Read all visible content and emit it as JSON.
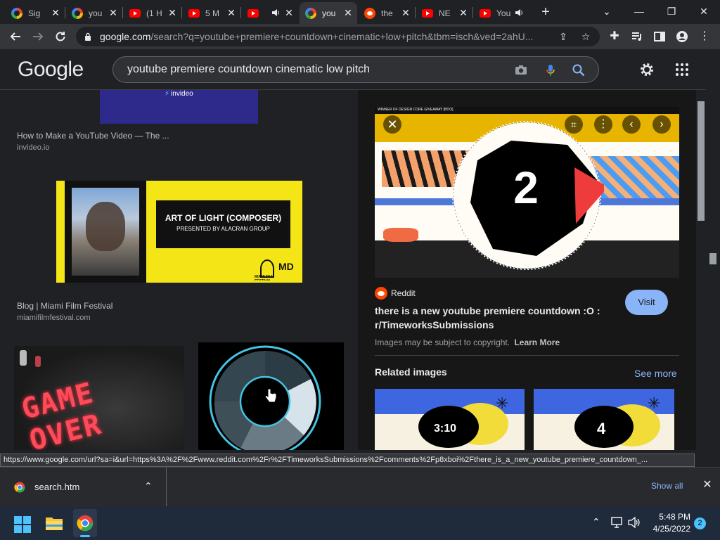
{
  "tabs": [
    {
      "label": "Sig",
      "favicon": "google-icon"
    },
    {
      "label": "you",
      "favicon": "google-icon"
    },
    {
      "label": "(1 H",
      "favicon": "youtube-icon"
    },
    {
      "label": "5 M",
      "favicon": "youtube-icon"
    },
    {
      "label": "",
      "favicon": "youtube-icon",
      "audio": true
    },
    {
      "label": "you",
      "favicon": "google-icon",
      "active": true
    },
    {
      "label": "the",
      "favicon": "reddit-icon"
    },
    {
      "label": "NE",
      "favicon": "youtube-icon"
    },
    {
      "label": "You",
      "favicon": "youtube-icon",
      "audio": true
    }
  ],
  "address": {
    "host": "google.com",
    "path": "/search?q=youtube+premiere+countdown+cinematic+low+pitch&tbm=isch&ved=2ahU..."
  },
  "google": {
    "logo": "Google",
    "query": "youtube premiere countdown cinematic low pitch"
  },
  "results": [
    {
      "title": "How to Make a YouTube Video — The ...",
      "source": "invideo.io",
      "thumb_text": "invideo"
    },
    {
      "title": "Blog | Miami Film Festival",
      "source": "miamifilmfestival.com",
      "thumb_heading": "ART OF LIGHT (COMPOSER)",
      "thumb_sub": "PRESENTED BY ALACRAN GROUP",
      "thumb_brand": "MIAMI FILM FESTIVAL"
    },
    {
      "thumb_text": "GAME OVER"
    }
  ],
  "panel": {
    "source": "Reddit",
    "preview_title": "WINNER OF DESIGN CORE GIVEAWAY [BOO]",
    "big_number": "2",
    "title_line1": "there is a new youtube premiere countdown :O :",
    "title_line2": "r/TimeworksSubmissions",
    "visit_label": "Visit",
    "copyright": "Images may be subject to copyright.",
    "learn_more": "Learn More",
    "related_heading": "Related images",
    "see_more": "See more",
    "related": [
      {
        "label": "3:10"
      },
      {
        "label": "4"
      }
    ]
  },
  "status_url": "https://www.google.com/url?sa=i&url=https%3A%2F%2Fwww.reddit.com%2Fr%2FTimeworksSubmissions%2Fcomments%2Fp8xboi%2Fthere_is_a_new_youtube_premiere_countdown_...",
  "download": {
    "filename": "search.htm",
    "show_all": "Show all"
  },
  "taskbar": {
    "time": "5:48 PM",
    "date": "4/25/2022",
    "notifications": "2"
  }
}
